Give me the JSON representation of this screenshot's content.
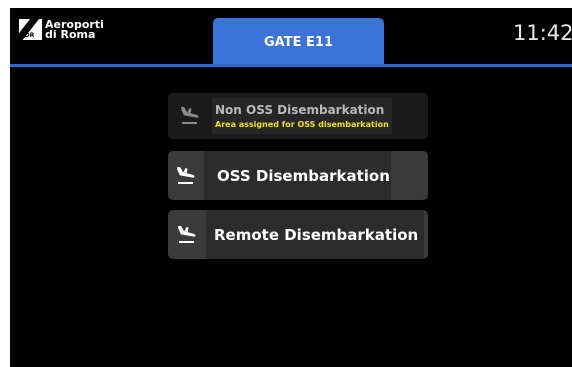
{
  "header": {
    "logo_line1": "Aeroporti",
    "logo_line2": "di Roma",
    "logo_mark_text": "ADR",
    "gate_tab_label": "GATE E11",
    "clock": "11:42"
  },
  "buttons": [
    {
      "title": "Non OSS Disembarkation",
      "subtitle": "Area assigned for OSS disembarkation",
      "icon": "plane-landing-icon",
      "enabled": false
    },
    {
      "title": "OSS Disembarkation",
      "icon": "plane-landing-icon",
      "enabled": true
    },
    {
      "title": "Remote Disembarkation",
      "icon": "plane-landing-icon",
      "enabled": true
    }
  ],
  "colors": {
    "background": "#010101",
    "accent_blue": "#3a74d8",
    "button_face": "#3b3b3b",
    "button_label": "#2c2c2c",
    "notice_yellow": "#f2e21c"
  }
}
